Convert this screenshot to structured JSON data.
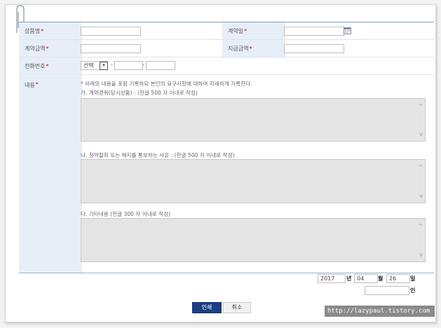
{
  "form": {
    "product_name": {
      "label": "상품명",
      "required_mark": "*",
      "value": ""
    },
    "contract_date": {
      "label": "계약일",
      "required_mark": "*",
      "value": "",
      "calendar_icon": "calendar-icon"
    },
    "contract_amount": {
      "label": "계약금액",
      "required_mark": "*",
      "value": ""
    },
    "payment_amount": {
      "label": "지급금액",
      "required_mark": "*",
      "value": ""
    },
    "phone": {
      "label": "전화번호",
      "required_mark": "*",
      "area_select": {
        "selected": "선택",
        "arrow": "▾"
      },
      "part2": "",
      "part3": "",
      "separator": "-"
    },
    "content": {
      "label": "내용",
      "required_mark": "*",
      "intro": "* 아래의 내용을 포함 기록하되 본인의 요구사항에 대하여 자세하게 기록한다.",
      "sections": [
        {
          "title": "가. 계약경위(당시상황) : (한글 500 자 이내로 작성)",
          "value": ""
        },
        {
          "title": "나. 청약철회 또는 해지를 통보하는 사유 : (한글 500 자 이내로 작성)",
          "value": ""
        },
        {
          "title": "다. 기타내용 (한글 300 자 이내로 작성)",
          "value": ""
        }
      ],
      "scroll_up": "^",
      "scroll_down": "v"
    }
  },
  "signature": {
    "year": "2017",
    "year_label": "년",
    "month": "04",
    "month_label": "월",
    "day": "26",
    "day_label": "일",
    "name": "",
    "name_label": "인"
  },
  "buttons": {
    "print": "인쇄",
    "cancel": "취소"
  },
  "watermark": "http://lazypaul.tistory.com",
  "colors": {
    "label_bg": "#e8eef8",
    "primary": "#1b3f86",
    "required": "#dd0000"
  }
}
